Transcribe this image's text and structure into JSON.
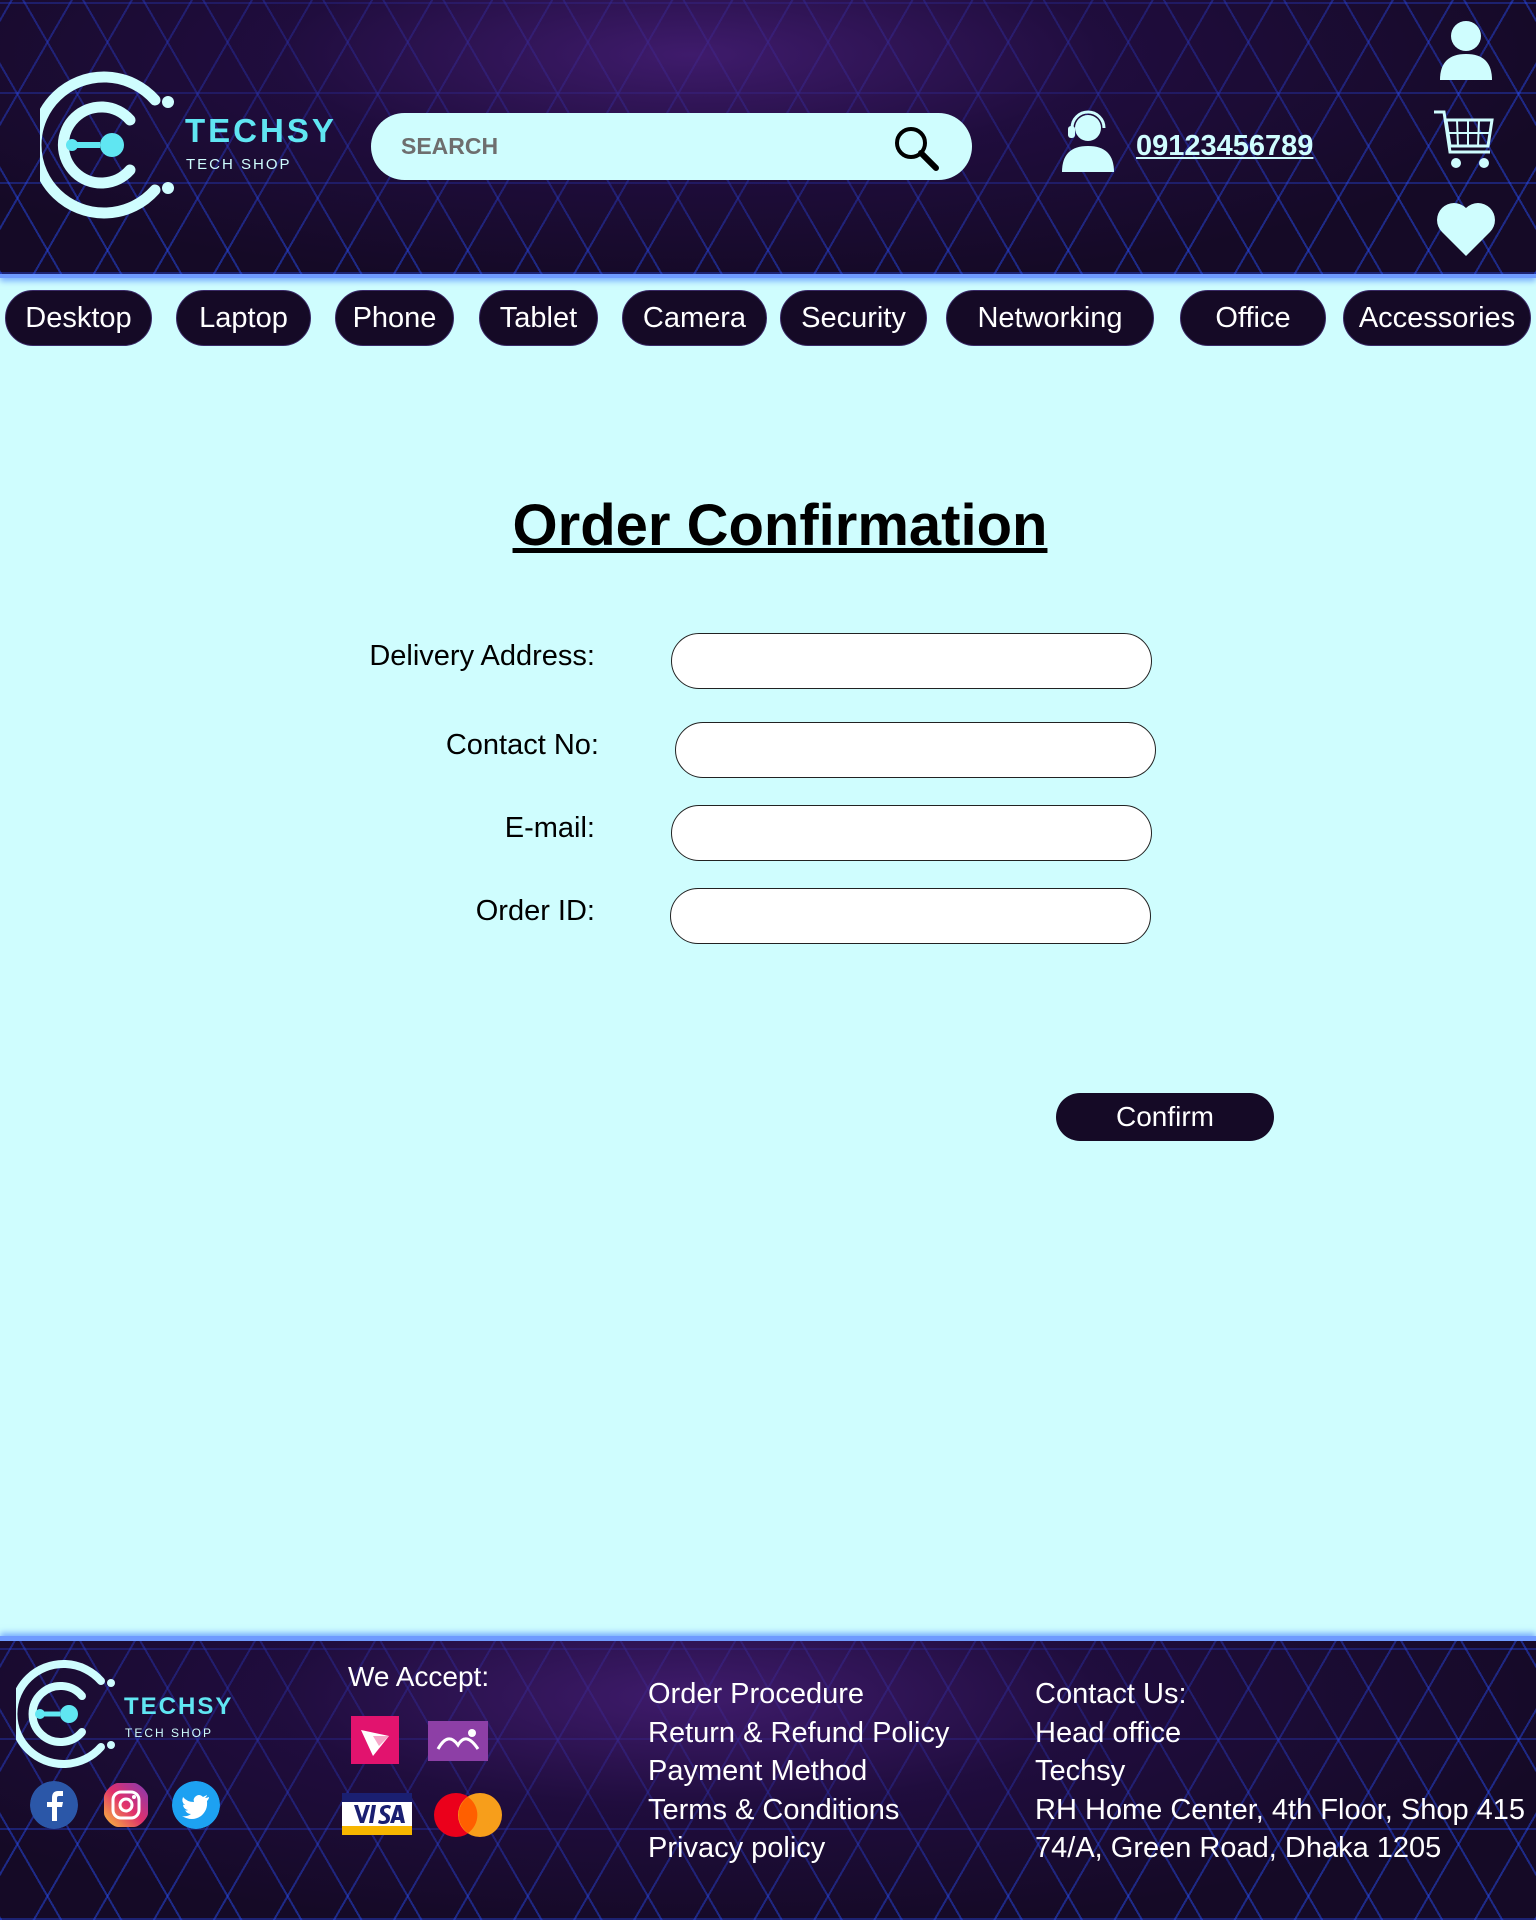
{
  "header": {
    "brand": "TECHSY",
    "brand_sub": "TECH SHOP",
    "search_placeholder": "SEARCH",
    "phone": "09123456789"
  },
  "nav": {
    "items": [
      "Desktop",
      "Laptop",
      "Phone",
      "Tablet",
      "Camera",
      "Security",
      "Networking",
      "Office",
      "Accessories"
    ]
  },
  "main": {
    "title": "Order Confirmation",
    "fields": {
      "delivery_address": "Delivery Address:",
      "contact_no": "Contact No:",
      "email": "E-mail:",
      "order_id": "Order ID:"
    },
    "confirm_label": "Confirm"
  },
  "footer": {
    "brand": "TECHSY",
    "brand_sub": "TECH SHOP",
    "we_accept": "We Accept:",
    "payment_methods": [
      "bKash",
      "Rocket",
      "VISA",
      "MasterCard"
    ],
    "links": [
      "Order Procedure",
      "Return & Refund Policy",
      "Payment Method",
      "Terms & Conditions",
      "Privacy policy"
    ],
    "contact": [
      "Contact Us:",
      "Head office",
      "Techsy",
      "RH Home Center, 4th Floor, Shop 415",
      "74/A, Green Road, Dhaka 1205"
    ],
    "social": [
      "facebook-icon",
      "instagram-icon",
      "twitter-icon"
    ]
  },
  "colors": {
    "background": "#cffdfe",
    "dark": "#150a26",
    "accent": "#60e6f2",
    "glow": "#6f9bff"
  }
}
